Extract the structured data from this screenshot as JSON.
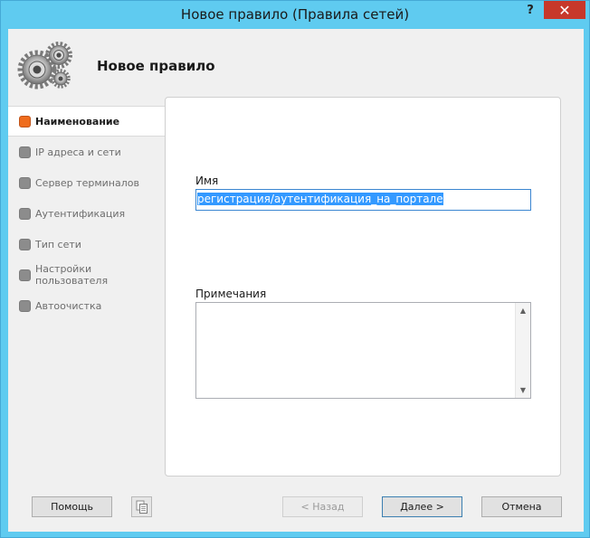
{
  "window": {
    "title": "Новое правило (Правила сетей)",
    "help_glyph": "?",
    "close_glyph": "✕"
  },
  "header": {
    "title": "Новое правило",
    "icon": "gears-icon"
  },
  "nav": {
    "items": [
      {
        "label": "Наименование",
        "active": true
      },
      {
        "label": "IP адреса и сети",
        "active": false
      },
      {
        "label": "Сервер терминалов",
        "active": false
      },
      {
        "label": "Аутентификация",
        "active": false
      },
      {
        "label": "Тип сети",
        "active": false
      },
      {
        "label": "Настройки пользователя",
        "active": false
      },
      {
        "label": "Автоочистка",
        "active": false
      }
    ]
  },
  "form": {
    "name_label": "Имя",
    "name_value": "регистрация/аутентификация_на_портале",
    "notes_label": "Примечания",
    "notes_value": ""
  },
  "footer": {
    "help_label": "Помощь",
    "copy_icon": "copy-icon",
    "back_label": "< Назад",
    "next_label": "Далее >",
    "cancel_label": "Отмена"
  },
  "colors": {
    "window_frame": "#5fcbf0",
    "active_marker": "#ef6c1c",
    "inactive_marker": "#8c8c8c",
    "selection": "#3399ff"
  }
}
